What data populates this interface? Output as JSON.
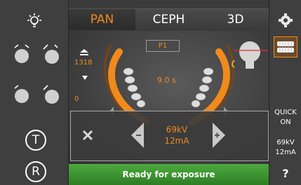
{
  "tabs": [
    {
      "label": "PAN",
      "active": true
    },
    {
      "label": "CEPH",
      "active": false
    },
    {
      "label": "3D",
      "active": false
    }
  ],
  "left_bar": {
    "timer_button_label": "T",
    "reset_button_label": "R"
  },
  "viewer": {
    "program_label": "P1",
    "height_value": "1318",
    "zero_value": "0",
    "exposure_time": "9.0 s"
  },
  "control_panel": {
    "kv": "69kV",
    "ma": "12mA"
  },
  "right_bar": {
    "quick_label": "QUICK",
    "quick_state": "ON",
    "kv": "69kV",
    "ma": "12mA",
    "help_label": "?"
  },
  "status": {
    "text": "Ready for exposure"
  },
  "colors": {
    "accent": "#f08a1c",
    "ready": "#3c9a30",
    "background": "#3b3b3b"
  }
}
